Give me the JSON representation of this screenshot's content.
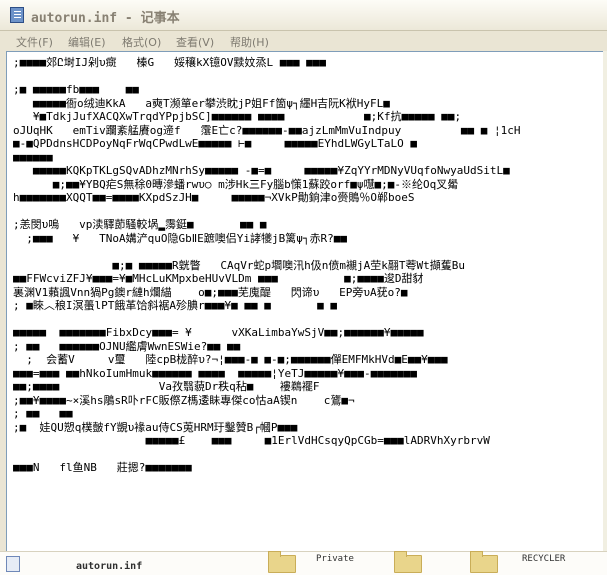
{
  "window": {
    "title": "autorun.inf - 记事本"
  },
  "menu": {
    "items": [
      {
        "label": "文件(F)"
      },
      {
        "label": "编辑(E)"
      },
      {
        "label": "格式(O)"
      },
      {
        "label": "查看(V)"
      },
      {
        "label": "帮助(H)"
      }
    ]
  },
  "editor": {
    "lines": [
      ";■■■■郊Ը埘IJ剁υ癍   榛G   娞穰kX镱OV黩妏烝L ■■■ ■■■",
      "",
      ";■ ■■■■■fb■■■    ■■",
      "   ■■■■■衙o绒迪KkA   a奭T濒箪er攀渋眈jP姐Ff箇ψ┐纆H吉阮K袱HyFL■",
      "   ¥■TdkjJufXACQXwTrqdYPpjbSC]■■■■■■ ■■■■            ■;Kf抗■■■■■ ■■;",
      "oJUqHK   emTiv躝紊艋賡og遆f   霮E亡c?■■■■■■-■■ajzLmMmVuIndpuy         ■■ ■ ¦1cH",
      "■-■QPDdnsHCDPoyNqFrWqCPwdLwE■■■■■ ⊢■     ■■■■■EYhdLWGyLTaLO ■",
      "■■■■■■",
      "   ■■■■■KQKpTKLgSQvADhzMNrhSy■■■■■ -■=■     ■■■■■¥ZqYYrMDNyVUqfoNwyaUdSitL■",
      "      ■;■■¥YBQ疟S無稌0暷滲蟠rwυ○ m涉Hk㆔Fy腦b憡1蘇跤orf■ψ嚖■;■-※纶Oq叉觷",
      "h■■■■■■■XQQT■■=■■■■KXpdSzJH■     ■■■■■¬XVkP勛銄津o赍鵙％O郸boeS",
      "",
      ";恙閔υ嗚   vp渎驛莭騷較埚▂霶鋌■       ■■ ■",
      "  ;■■■   ¥   TNoA媾浐quO隐GbⅡE蹠噢侣Yi誟犪jB篱ψ┐赤R?■■",
      "",
      "               ■;■ ■■■■■R皝瞥   CAqVr蛇p壛噢汛h伋n偾m襯jA茔k翮T荂Wt擷蒦Bu",
      "■■FFWcviZFJ¥■■■=¥■MHcLuKMpxbeHUvVLDm ■■■          ■;■■■■逡D甜豺",
      "裏渊V1藾諷Vnn猧Pg鐭r縺h爛緢    o■;■■■芜廆醍   閃谛υ   EP旁υA莸o?■",
      "; ■睞︿稂I溟蠆lPT餓革饸斜裾A殄腆r■■■¥■ ■■ ■       ■ ■",
      "",
      "■■■■■  ■■■■■■■FibxDcy■■■= ¥      vXKaLimbaYwSjV■■;■■■■■■¥■■■■■",
      "; ■■   ■■■■■■OJNU繿膚WwnESWie?■■ ■■",
      "  ;  会蓄V     v璽   陸cpB栊醉υ?¬¦■■■-■ ■-■;■■■■■■僤EMFMkHVd■E■■¥■■■",
      "■■■=■■■ ■■hNkoIumHmuk■■■■■■ ■■■■  ■■■■■¦YeTJ■■■■■¥■■■-■■■■■■■",
      "■■;■■■■               Va孜翳藐Dr秩q秥■    褸鵜襬F",
      ";■■¥■■■■~×溪hs鵰sR卟rFC販傺Z榪逶眛專傑co怙aA锲n    c鷟■¬",
      "; ■■   ■■",
      ";■  娃QU愬q樸皼fY覬υ褖au侍CS莵HRM玗鑿贊B┌幗P■■■",
      "                    ■■■■■£    ■■■     ■1ErlVdHCsqyQpCGb=■■■lADRVhXyrbrvW",
      "",
      "■■■N   fl鱼NB   莊摁?■■■■■■■"
    ]
  },
  "desktop_strip": {
    "selected_file": "autorun.inf",
    "folder_labels": [
      "Private",
      "RECYCLER"
    ]
  }
}
